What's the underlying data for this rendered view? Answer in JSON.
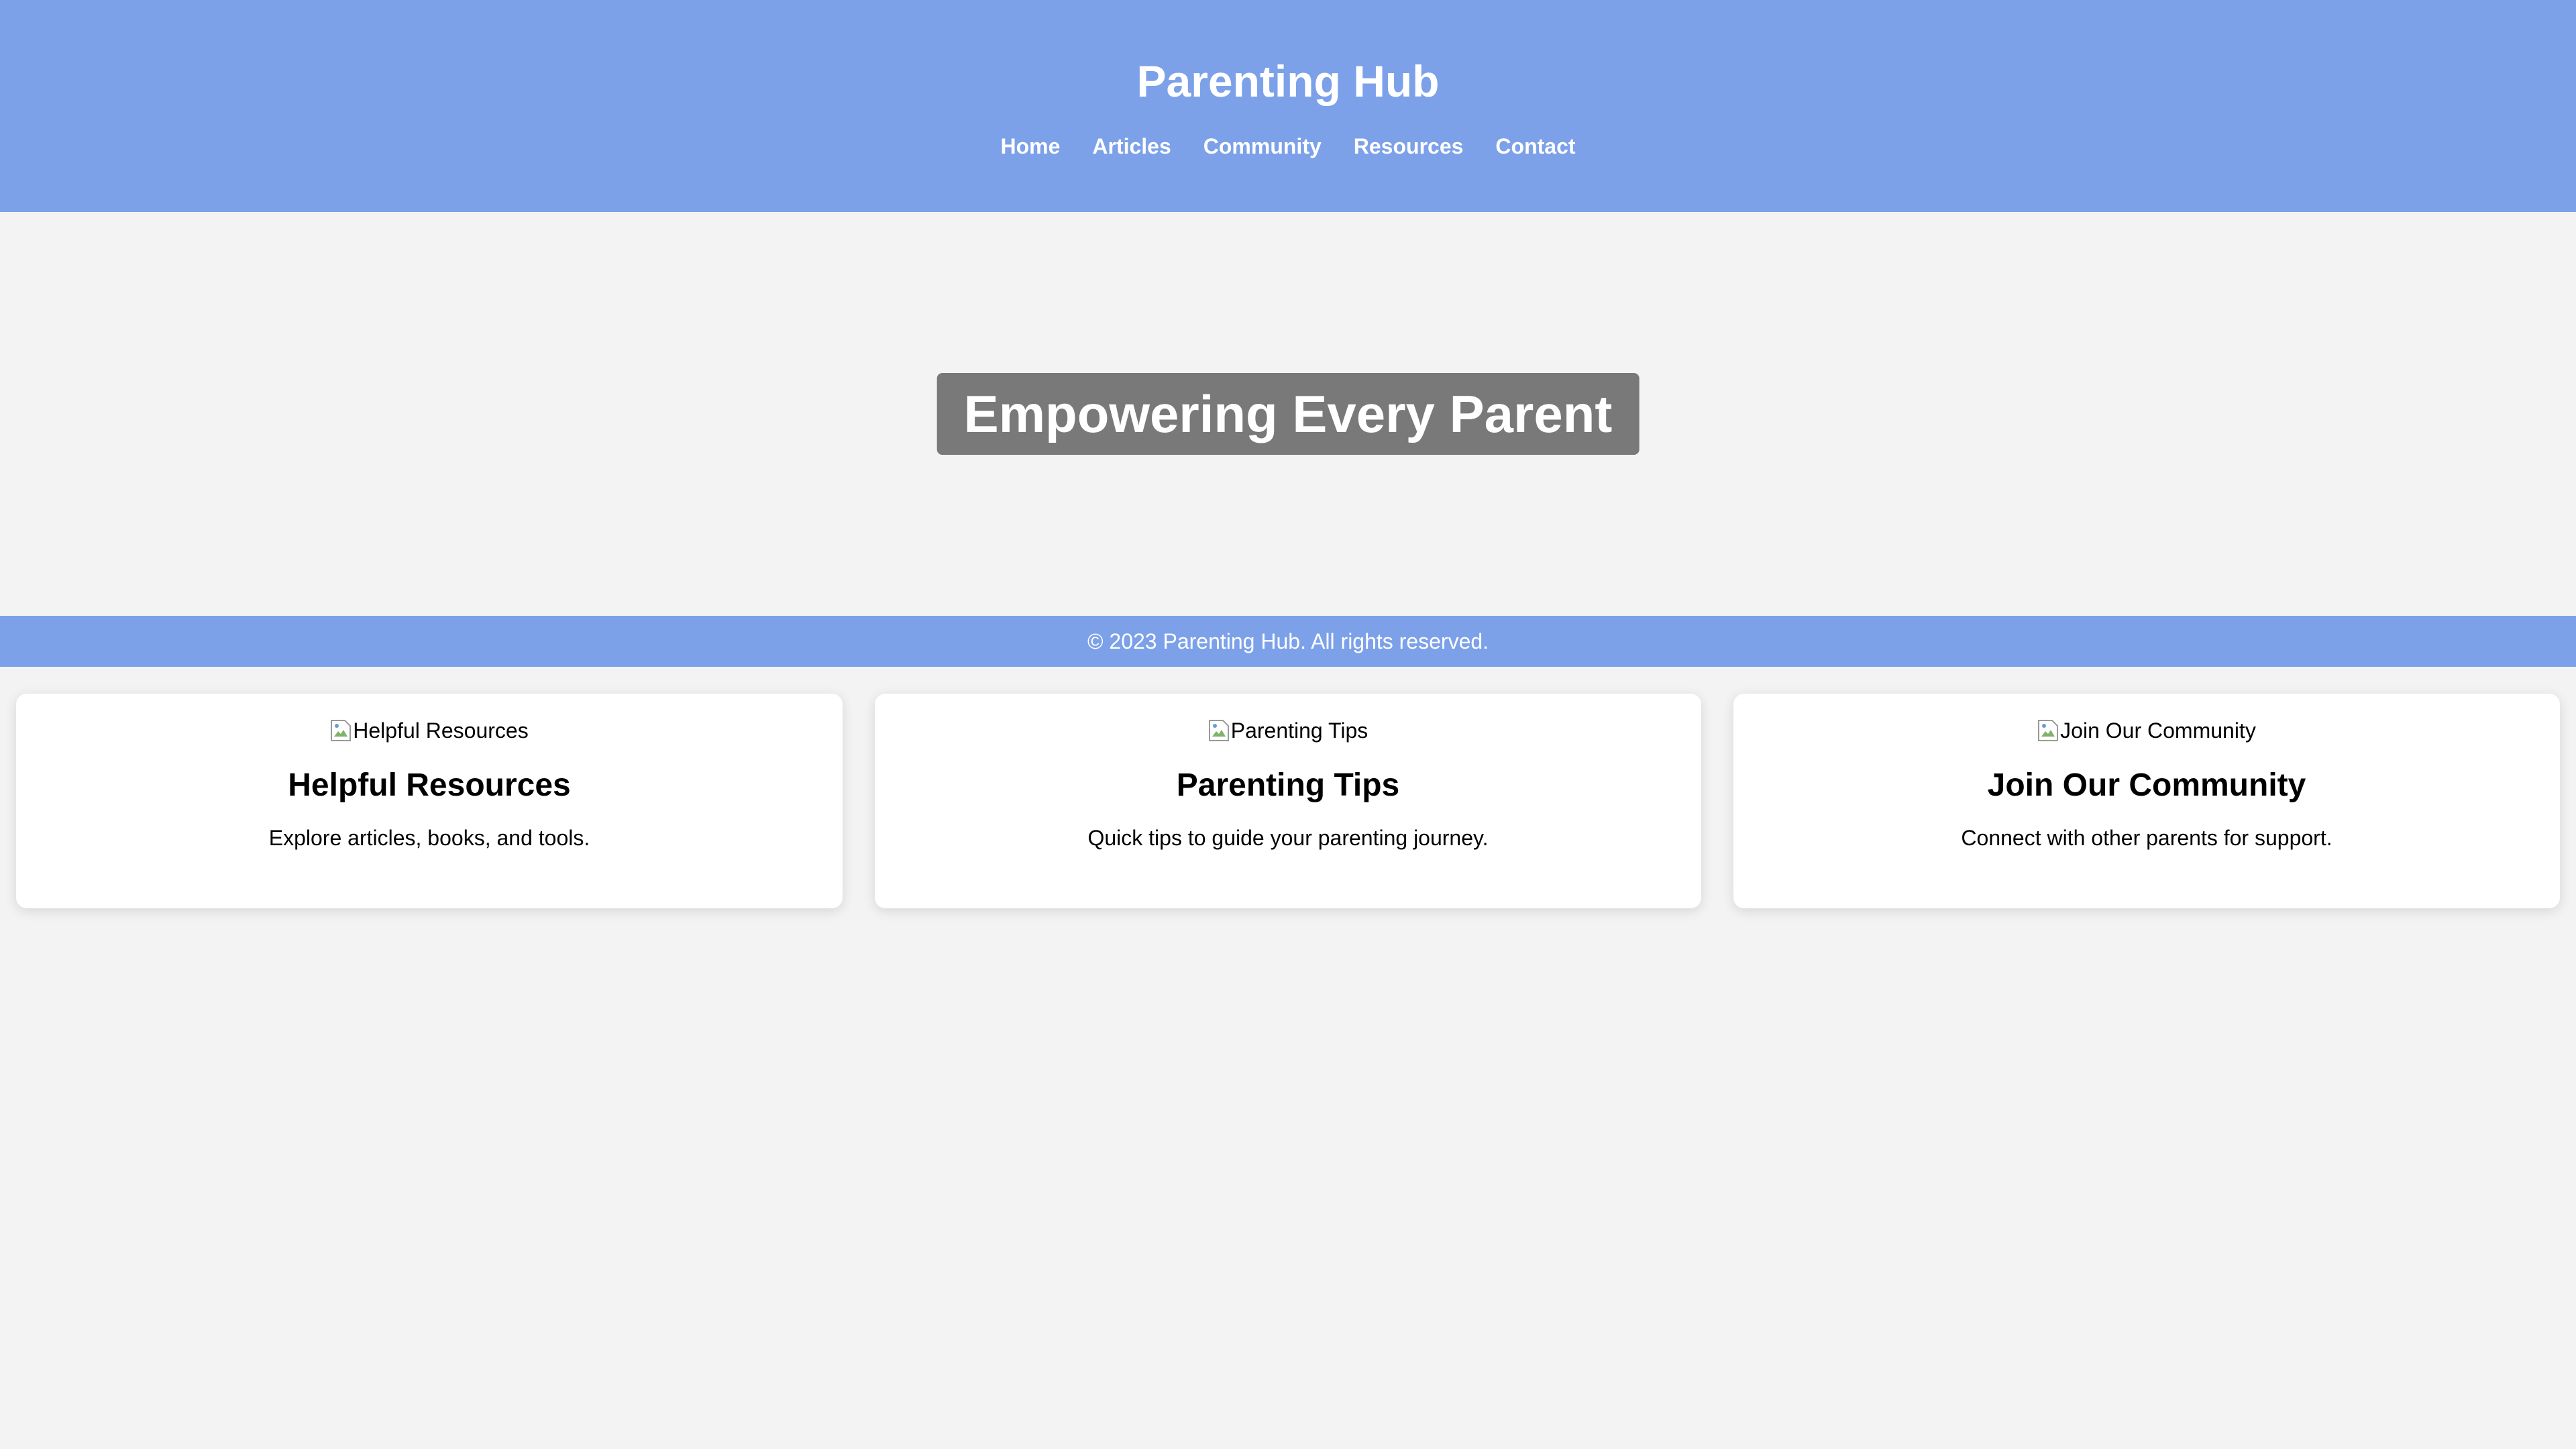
{
  "header": {
    "title": "Parenting Hub",
    "nav": [
      "Home",
      "Articles",
      "Community",
      "Resources",
      "Contact"
    ]
  },
  "hero": {
    "heading": "Empowering Every Parent"
  },
  "footer": {
    "text": "© 2023 Parenting Hub. All rights reserved."
  },
  "cards": [
    {
      "image_alt": "Helpful Resources",
      "title": "Helpful Resources",
      "description": "Explore articles, books, and tools."
    },
    {
      "image_alt": "Parenting Tips",
      "title": "Parenting Tips",
      "description": "Quick tips to guide your parenting journey."
    },
    {
      "image_alt": "Join Our Community",
      "title": "Join Our Community",
      "description": "Connect with other parents for support."
    }
  ],
  "colors": {
    "header_bg": "#7ca1e9",
    "page_bg": "#f3f3f3",
    "card_bg": "#ffffff"
  }
}
